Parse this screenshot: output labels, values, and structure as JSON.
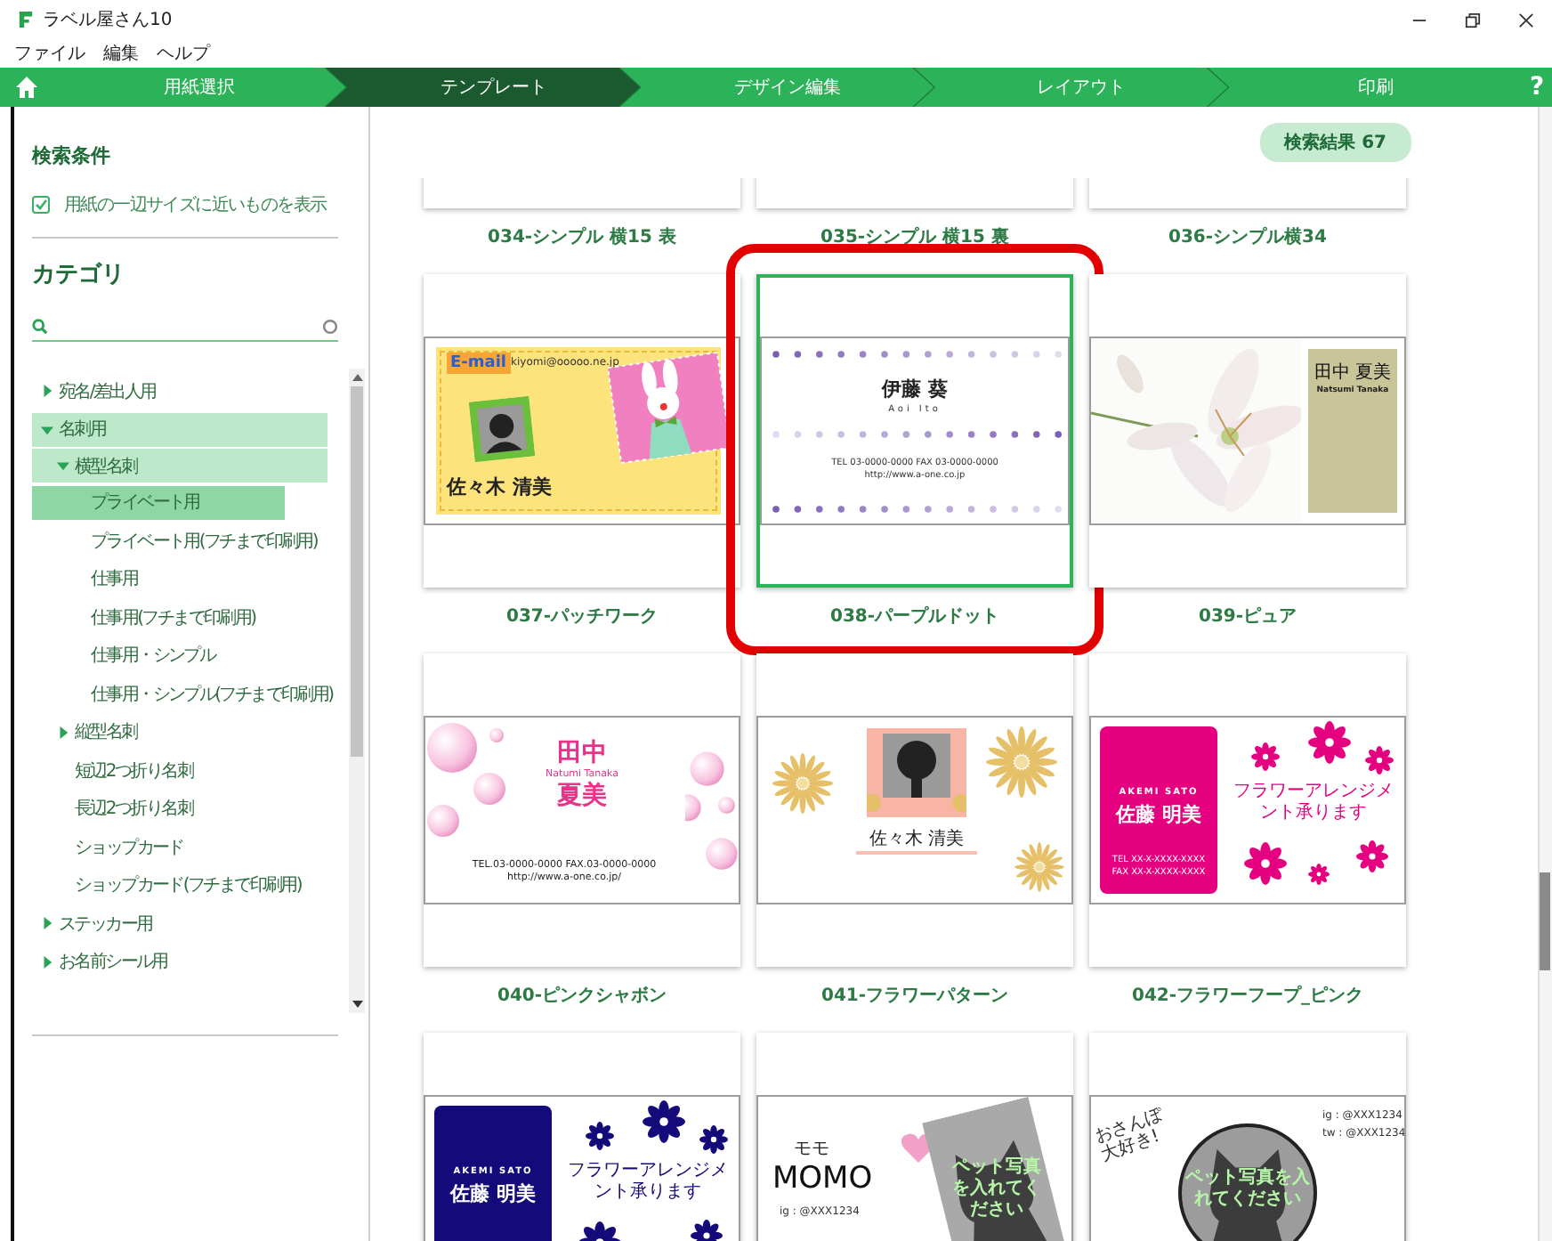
{
  "window": {
    "title": "ラベル屋さん10"
  },
  "menu": [
    "ファイル",
    "編集",
    "ヘルプ"
  ],
  "steps": [
    {
      "label": "用紙選択",
      "selected": false
    },
    {
      "label": "テンプレート",
      "selected": true
    },
    {
      "label": "デザイン編集",
      "selected": false
    },
    {
      "label": "レイアウト",
      "selected": false
    },
    {
      "label": "印刷",
      "selected": false
    }
  ],
  "help": "?",
  "sidebar": {
    "conditions_title": "検索条件",
    "filter": {
      "label": "用紙の一辺サイズに近いものを表示",
      "checked": true
    },
    "category_title": "カテゴリ",
    "tree": [
      {
        "label": "宛名/差出人用",
        "expanded": false,
        "selected": false
      },
      {
        "label": "名刺用",
        "expanded": true,
        "selected": false,
        "children": [
          {
            "label": "横型名刺",
            "expanded": true,
            "selected": false,
            "children": [
              {
                "label": "プライベート用",
                "selected": true
              },
              {
                "label": "プライベート用(フチまで印刷用)",
                "selected": false
              },
              {
                "label": "仕事用",
                "selected": false
              },
              {
                "label": "仕事用(フチまで印刷用)",
                "selected": false
              },
              {
                "label": "仕事用・シンプル",
                "selected": false
              },
              {
                "label": "仕事用・シンプル(フチまで印刷用)",
                "selected": false
              }
            ]
          },
          {
            "label": "縦型名刺",
            "expanded": false,
            "selected": false
          },
          {
            "label": "短辺2つ折り名刺",
            "selected": false
          },
          {
            "label": "長辺2つ折り名刺",
            "selected": false
          },
          {
            "label": "ショップカード",
            "selected": false
          },
          {
            "label": "ショップカード(フチまで印刷用)",
            "selected": false
          }
        ]
      },
      {
        "label": "ステッカー用",
        "expanded": false,
        "selected": false
      },
      {
        "label": "お名前シール用",
        "expanded": false,
        "selected": false
      }
    ]
  },
  "results": "検索結果 67",
  "templates": [
    {
      "label": "034-シンプル 横15 表",
      "selected": false,
      "marked": false
    },
    {
      "label": "035-シンプル 横15 裏",
      "selected": false,
      "marked": false
    },
    {
      "label": "036-シンプル横34",
      "selected": false,
      "marked": false
    },
    {
      "label": "037-パッチワーク",
      "selected": false,
      "marked": false,
      "design": {
        "kind": "patchwork",
        "tag": "E-mail",
        "email": "kiyomi@ooooo.ne.jp",
        "name": "佐々木 清美"
      }
    },
    {
      "label": "038-パープルドット",
      "selected": true,
      "marked": true,
      "design": {
        "kind": "purple-dot",
        "name": "伊藤 葵",
        "romaji": "Aoi Ito",
        "lines": [
          "TEL 03-0000-0000 FAX 03-0000-0000",
          "http://www.a-one.co.jp"
        ]
      }
    },
    {
      "label": "039-ピュア",
      "selected": false,
      "marked": false,
      "design": {
        "kind": "pure",
        "name": "田中 夏美",
        "romaji": "Natsumi Tanaka"
      }
    },
    {
      "label": "040-ピンクシャボン",
      "selected": false,
      "marked": false,
      "design": {
        "kind": "pink-bubble",
        "surname": "田中",
        "romaji": "Natumi Tanaka",
        "given": "夏美",
        "lines": [
          "TEL.03-0000-0000 FAX.03-0000-0000",
          "http://www.a-one.co.jp/"
        ]
      }
    },
    {
      "label": "041-フラワーパターン",
      "selected": false,
      "marked": false,
      "design": {
        "kind": "flower-pattern",
        "name": "佐々木 清美"
      }
    },
    {
      "label": "042-フラワーフープ_ピンク",
      "selected": false,
      "marked": false,
      "design": {
        "kind": "flower-panel",
        "color": "#e4007f",
        "romaji": "AKEMI SATO",
        "name": "佐藤 明美",
        "caption": "フラワーアレンジメント承ります",
        "lines": [
          "TEL XX-X-XXXX-XXXX",
          "FAX XX-X-XXXX-XXXX"
        ]
      }
    },
    {
      "selected": false,
      "marked": false,
      "design": {
        "kind": "flower-panel",
        "color": "#140a7a",
        "romaji": "AKEMI SATO",
        "name": "佐藤 明美",
        "caption": "フラワーアレンジメント承ります"
      }
    },
    {
      "selected": false,
      "marked": false,
      "design": {
        "kind": "pet-photo",
        "kana": "モモ",
        "name": "MOMO",
        "handles": [
          "ig : @XXX1234"
        ],
        "caption": "ペット写真を入れてください"
      }
    },
    {
      "selected": false,
      "marked": false,
      "design": {
        "kind": "pet-circle",
        "slogan": "おさんぽ大好き!",
        "handles": [
          "ig : @XXX1234",
          "tw : @XXX1234"
        ],
        "caption": "ペット写真を入れてください"
      }
    }
  ]
}
